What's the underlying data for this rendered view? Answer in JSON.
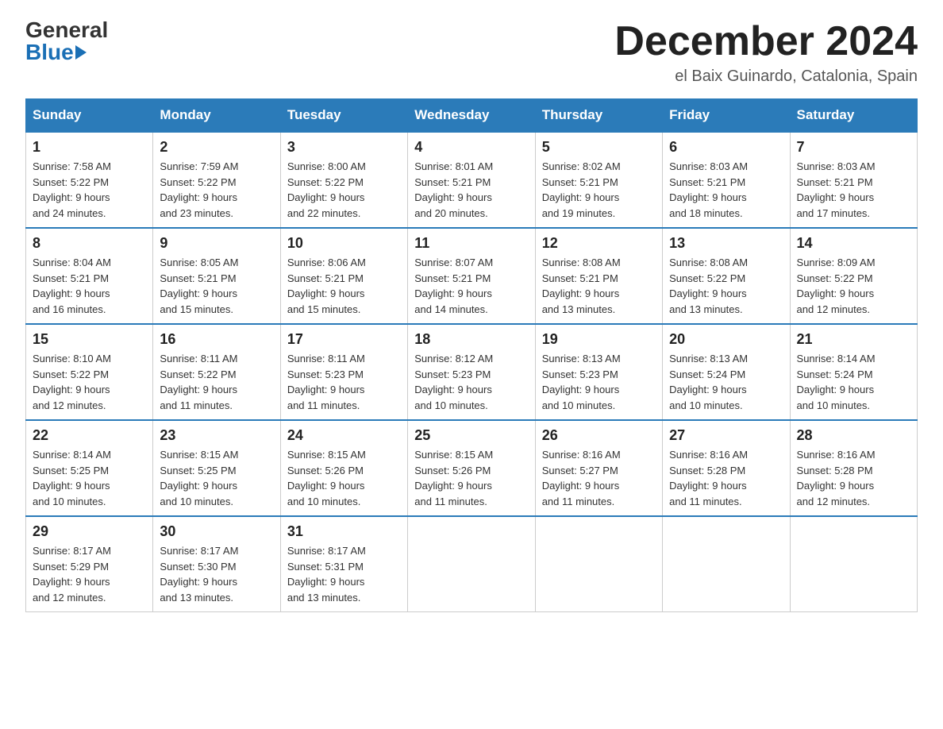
{
  "header": {
    "logo_general": "General",
    "logo_blue": "Blue",
    "month_title": "December 2024",
    "location": "el Baix Guinardo, Catalonia, Spain"
  },
  "days_of_week": [
    "Sunday",
    "Monday",
    "Tuesday",
    "Wednesday",
    "Thursday",
    "Friday",
    "Saturday"
  ],
  "weeks": [
    [
      {
        "day": "1",
        "sunrise": "7:58 AM",
        "sunset": "5:22 PM",
        "daylight": "9 hours and 24 minutes."
      },
      {
        "day": "2",
        "sunrise": "7:59 AM",
        "sunset": "5:22 PM",
        "daylight": "9 hours and 23 minutes."
      },
      {
        "day": "3",
        "sunrise": "8:00 AM",
        "sunset": "5:22 PM",
        "daylight": "9 hours and 22 minutes."
      },
      {
        "day": "4",
        "sunrise": "8:01 AM",
        "sunset": "5:21 PM",
        "daylight": "9 hours and 20 minutes."
      },
      {
        "day": "5",
        "sunrise": "8:02 AM",
        "sunset": "5:21 PM",
        "daylight": "9 hours and 19 minutes."
      },
      {
        "day": "6",
        "sunrise": "8:03 AM",
        "sunset": "5:21 PM",
        "daylight": "9 hours and 18 minutes."
      },
      {
        "day": "7",
        "sunrise": "8:03 AM",
        "sunset": "5:21 PM",
        "daylight": "9 hours and 17 minutes."
      }
    ],
    [
      {
        "day": "8",
        "sunrise": "8:04 AM",
        "sunset": "5:21 PM",
        "daylight": "9 hours and 16 minutes."
      },
      {
        "day": "9",
        "sunrise": "8:05 AM",
        "sunset": "5:21 PM",
        "daylight": "9 hours and 15 minutes."
      },
      {
        "day": "10",
        "sunrise": "8:06 AM",
        "sunset": "5:21 PM",
        "daylight": "9 hours and 15 minutes."
      },
      {
        "day": "11",
        "sunrise": "8:07 AM",
        "sunset": "5:21 PM",
        "daylight": "9 hours and 14 minutes."
      },
      {
        "day": "12",
        "sunrise": "8:08 AM",
        "sunset": "5:21 PM",
        "daylight": "9 hours and 13 minutes."
      },
      {
        "day": "13",
        "sunrise": "8:08 AM",
        "sunset": "5:22 PM",
        "daylight": "9 hours and 13 minutes."
      },
      {
        "day": "14",
        "sunrise": "8:09 AM",
        "sunset": "5:22 PM",
        "daylight": "9 hours and 12 minutes."
      }
    ],
    [
      {
        "day": "15",
        "sunrise": "8:10 AM",
        "sunset": "5:22 PM",
        "daylight": "9 hours and 12 minutes."
      },
      {
        "day": "16",
        "sunrise": "8:11 AM",
        "sunset": "5:22 PM",
        "daylight": "9 hours and 11 minutes."
      },
      {
        "day": "17",
        "sunrise": "8:11 AM",
        "sunset": "5:23 PM",
        "daylight": "9 hours and 11 minutes."
      },
      {
        "day": "18",
        "sunrise": "8:12 AM",
        "sunset": "5:23 PM",
        "daylight": "9 hours and 10 minutes."
      },
      {
        "day": "19",
        "sunrise": "8:13 AM",
        "sunset": "5:23 PM",
        "daylight": "9 hours and 10 minutes."
      },
      {
        "day": "20",
        "sunrise": "8:13 AM",
        "sunset": "5:24 PM",
        "daylight": "9 hours and 10 minutes."
      },
      {
        "day": "21",
        "sunrise": "8:14 AM",
        "sunset": "5:24 PM",
        "daylight": "9 hours and 10 minutes."
      }
    ],
    [
      {
        "day": "22",
        "sunrise": "8:14 AM",
        "sunset": "5:25 PM",
        "daylight": "9 hours and 10 minutes."
      },
      {
        "day": "23",
        "sunrise": "8:15 AM",
        "sunset": "5:25 PM",
        "daylight": "9 hours and 10 minutes."
      },
      {
        "day": "24",
        "sunrise": "8:15 AM",
        "sunset": "5:26 PM",
        "daylight": "9 hours and 10 minutes."
      },
      {
        "day": "25",
        "sunrise": "8:15 AM",
        "sunset": "5:26 PM",
        "daylight": "9 hours and 11 minutes."
      },
      {
        "day": "26",
        "sunrise": "8:16 AM",
        "sunset": "5:27 PM",
        "daylight": "9 hours and 11 minutes."
      },
      {
        "day": "27",
        "sunrise": "8:16 AM",
        "sunset": "5:28 PM",
        "daylight": "9 hours and 11 minutes."
      },
      {
        "day": "28",
        "sunrise": "8:16 AM",
        "sunset": "5:28 PM",
        "daylight": "9 hours and 12 minutes."
      }
    ],
    [
      {
        "day": "29",
        "sunrise": "8:17 AM",
        "sunset": "5:29 PM",
        "daylight": "9 hours and 12 minutes."
      },
      {
        "day": "30",
        "sunrise": "8:17 AM",
        "sunset": "5:30 PM",
        "daylight": "9 hours and 13 minutes."
      },
      {
        "day": "31",
        "sunrise": "8:17 AM",
        "sunset": "5:31 PM",
        "daylight": "9 hours and 13 minutes."
      },
      null,
      null,
      null,
      null
    ]
  ],
  "labels": {
    "sunrise": "Sunrise:",
    "sunset": "Sunset:",
    "daylight": "Daylight:"
  }
}
